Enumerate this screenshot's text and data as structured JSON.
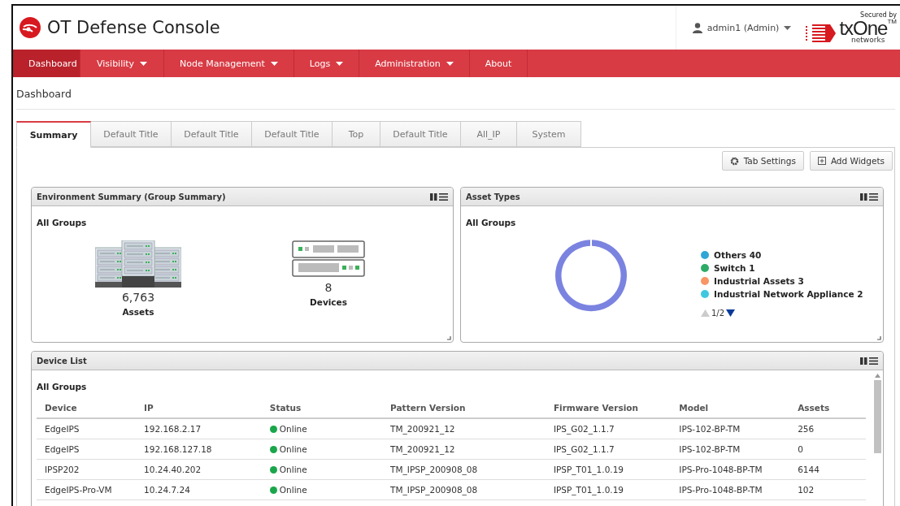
{
  "header": {
    "title": "OT Defense Console",
    "user": "admin1 (Admin)",
    "brand_tagline": "Secured by",
    "brand_name": "txOne",
    "brand_tm": "TM",
    "brand_sub": "networks"
  },
  "nav": [
    {
      "label": "Dashboard",
      "selected": true,
      "has_menu": false
    },
    {
      "label": "Visibility",
      "selected": false,
      "has_menu": true
    },
    {
      "label": "Node Management",
      "selected": false,
      "has_menu": true
    },
    {
      "label": "Logs",
      "selected": false,
      "has_menu": true
    },
    {
      "label": "Administration",
      "selected": false,
      "has_menu": true
    },
    {
      "label": "About",
      "selected": false,
      "has_menu": false
    }
  ],
  "breadcrumb": "Dashboard",
  "tabs": [
    {
      "label": "Summary",
      "selected": true
    },
    {
      "label": "Default Title",
      "selected": false
    },
    {
      "label": "Default Title",
      "selected": false
    },
    {
      "label": "Default Title",
      "selected": false
    },
    {
      "label": "Top",
      "selected": false
    },
    {
      "label": "Default Title",
      "selected": false
    },
    {
      "label": "All_IP",
      "selected": false
    },
    {
      "label": "System",
      "selected": false
    }
  ],
  "toolbar": [
    {
      "label": "Tab Settings",
      "kind": "gear"
    },
    {
      "label": "Add Widgets",
      "kind": "add"
    }
  ],
  "env_summary": {
    "title": "Environment Summary (Group Summary)",
    "group": "All Groups",
    "stats": [
      {
        "kind": "assets",
        "value": "6,763",
        "label": "Assets"
      },
      {
        "kind": "devices",
        "value": "8",
        "label": "Devices"
      }
    ]
  },
  "asset_types": {
    "title": "Asset Types",
    "group": "All Groups",
    "legend": [
      {
        "label": "Others 40",
        "color": "#2fa6d6"
      },
      {
        "label": "Switch 1",
        "color": "#2dab66"
      },
      {
        "label": "Industrial Assets 3",
        "color": "#f79664"
      },
      {
        "label": "Industrial Network Appliance 2",
        "color": "#3ec8e0"
      }
    ],
    "page": "1/2"
  },
  "device_list": {
    "title": "Device List",
    "group": "All Groups",
    "columns": [
      "Device",
      "IP",
      "Status",
      "Pattern Version",
      "Firmware Version",
      "Model",
      "Assets"
    ],
    "rows": [
      {
        "device": "EdgeIPS",
        "ip": "192.168.2.17",
        "status": "Online",
        "online": true,
        "pattern": "TM_200921_12",
        "firmware": "IPS_G02_1.1.7",
        "model": "IPS-102-BP-TM",
        "assets": "256"
      },
      {
        "device": "EdgeIPS",
        "ip": "192.168.127.18",
        "status": "Online",
        "online": true,
        "pattern": "TM_200921_12",
        "firmware": "IPS_G02_1.1.7",
        "model": "IPS-102-BP-TM",
        "assets": "0"
      },
      {
        "device": "IPSP202",
        "ip": "10.24.40.202",
        "status": "Online",
        "online": true,
        "pattern": "TM_IPSP_200908_08",
        "firmware": "IPSP_T01_1.0.19",
        "model": "IPS-Pro-1048-BP-TM",
        "assets": "6144"
      },
      {
        "device": "EdgeIPS-Pro-VM",
        "ip": "10.24.7.24",
        "status": "Online",
        "online": true,
        "pattern": "TM_IPSP_200908_08",
        "firmware": "IPSP_T01_1.0.19",
        "model": "IPS-Pro-1048-BP-TM",
        "assets": "102"
      }
    ]
  }
}
